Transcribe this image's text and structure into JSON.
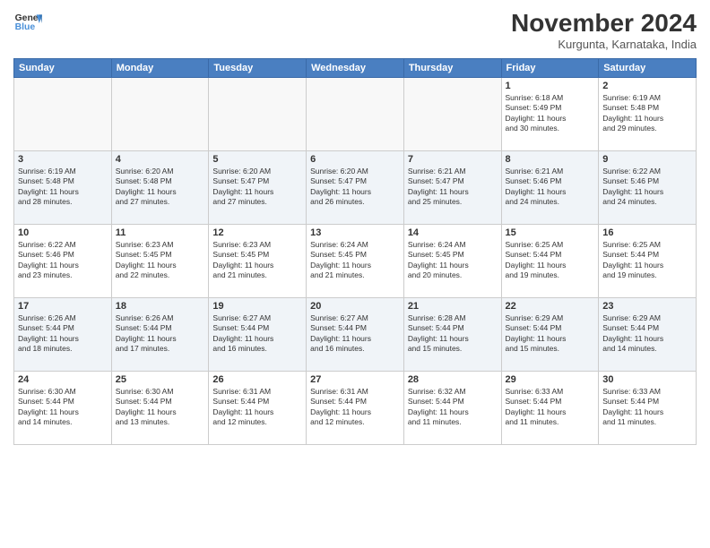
{
  "header": {
    "logo_line1": "General",
    "logo_line2": "Blue",
    "month_title": "November 2024",
    "location": "Kurgunta, Karnataka, India"
  },
  "weekdays": [
    "Sunday",
    "Monday",
    "Tuesday",
    "Wednesday",
    "Thursday",
    "Friday",
    "Saturday"
  ],
  "weeks": [
    {
      "alt": false,
      "days": [
        {
          "num": "",
          "info": ""
        },
        {
          "num": "",
          "info": ""
        },
        {
          "num": "",
          "info": ""
        },
        {
          "num": "",
          "info": ""
        },
        {
          "num": "",
          "info": ""
        },
        {
          "num": "1",
          "info": "Sunrise: 6:18 AM\nSunset: 5:49 PM\nDaylight: 11 hours\nand 30 minutes."
        },
        {
          "num": "2",
          "info": "Sunrise: 6:19 AM\nSunset: 5:48 PM\nDaylight: 11 hours\nand 29 minutes."
        }
      ]
    },
    {
      "alt": true,
      "days": [
        {
          "num": "3",
          "info": "Sunrise: 6:19 AM\nSunset: 5:48 PM\nDaylight: 11 hours\nand 28 minutes."
        },
        {
          "num": "4",
          "info": "Sunrise: 6:20 AM\nSunset: 5:48 PM\nDaylight: 11 hours\nand 27 minutes."
        },
        {
          "num": "5",
          "info": "Sunrise: 6:20 AM\nSunset: 5:47 PM\nDaylight: 11 hours\nand 27 minutes."
        },
        {
          "num": "6",
          "info": "Sunrise: 6:20 AM\nSunset: 5:47 PM\nDaylight: 11 hours\nand 26 minutes."
        },
        {
          "num": "7",
          "info": "Sunrise: 6:21 AM\nSunset: 5:47 PM\nDaylight: 11 hours\nand 25 minutes."
        },
        {
          "num": "8",
          "info": "Sunrise: 6:21 AM\nSunset: 5:46 PM\nDaylight: 11 hours\nand 24 minutes."
        },
        {
          "num": "9",
          "info": "Sunrise: 6:22 AM\nSunset: 5:46 PM\nDaylight: 11 hours\nand 24 minutes."
        }
      ]
    },
    {
      "alt": false,
      "days": [
        {
          "num": "10",
          "info": "Sunrise: 6:22 AM\nSunset: 5:46 PM\nDaylight: 11 hours\nand 23 minutes."
        },
        {
          "num": "11",
          "info": "Sunrise: 6:23 AM\nSunset: 5:45 PM\nDaylight: 11 hours\nand 22 minutes."
        },
        {
          "num": "12",
          "info": "Sunrise: 6:23 AM\nSunset: 5:45 PM\nDaylight: 11 hours\nand 21 minutes."
        },
        {
          "num": "13",
          "info": "Sunrise: 6:24 AM\nSunset: 5:45 PM\nDaylight: 11 hours\nand 21 minutes."
        },
        {
          "num": "14",
          "info": "Sunrise: 6:24 AM\nSunset: 5:45 PM\nDaylight: 11 hours\nand 20 minutes."
        },
        {
          "num": "15",
          "info": "Sunrise: 6:25 AM\nSunset: 5:44 PM\nDaylight: 11 hours\nand 19 minutes."
        },
        {
          "num": "16",
          "info": "Sunrise: 6:25 AM\nSunset: 5:44 PM\nDaylight: 11 hours\nand 19 minutes."
        }
      ]
    },
    {
      "alt": true,
      "days": [
        {
          "num": "17",
          "info": "Sunrise: 6:26 AM\nSunset: 5:44 PM\nDaylight: 11 hours\nand 18 minutes."
        },
        {
          "num": "18",
          "info": "Sunrise: 6:26 AM\nSunset: 5:44 PM\nDaylight: 11 hours\nand 17 minutes."
        },
        {
          "num": "19",
          "info": "Sunrise: 6:27 AM\nSunset: 5:44 PM\nDaylight: 11 hours\nand 16 minutes."
        },
        {
          "num": "20",
          "info": "Sunrise: 6:27 AM\nSunset: 5:44 PM\nDaylight: 11 hours\nand 16 minutes."
        },
        {
          "num": "21",
          "info": "Sunrise: 6:28 AM\nSunset: 5:44 PM\nDaylight: 11 hours\nand 15 minutes."
        },
        {
          "num": "22",
          "info": "Sunrise: 6:29 AM\nSunset: 5:44 PM\nDaylight: 11 hours\nand 15 minutes."
        },
        {
          "num": "23",
          "info": "Sunrise: 6:29 AM\nSunset: 5:44 PM\nDaylight: 11 hours\nand 14 minutes."
        }
      ]
    },
    {
      "alt": false,
      "days": [
        {
          "num": "24",
          "info": "Sunrise: 6:30 AM\nSunset: 5:44 PM\nDaylight: 11 hours\nand 14 minutes."
        },
        {
          "num": "25",
          "info": "Sunrise: 6:30 AM\nSunset: 5:44 PM\nDaylight: 11 hours\nand 13 minutes."
        },
        {
          "num": "26",
          "info": "Sunrise: 6:31 AM\nSunset: 5:44 PM\nDaylight: 11 hours\nand 12 minutes."
        },
        {
          "num": "27",
          "info": "Sunrise: 6:31 AM\nSunset: 5:44 PM\nDaylight: 11 hours\nand 12 minutes."
        },
        {
          "num": "28",
          "info": "Sunrise: 6:32 AM\nSunset: 5:44 PM\nDaylight: 11 hours\nand 11 minutes."
        },
        {
          "num": "29",
          "info": "Sunrise: 6:33 AM\nSunset: 5:44 PM\nDaylight: 11 hours\nand 11 minutes."
        },
        {
          "num": "30",
          "info": "Sunrise: 6:33 AM\nSunset: 5:44 PM\nDaylight: 11 hours\nand 11 minutes."
        }
      ]
    }
  ]
}
